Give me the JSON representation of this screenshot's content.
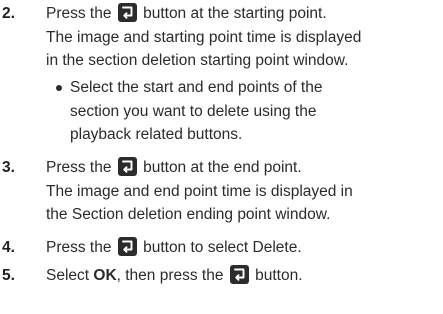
{
  "steps": [
    {
      "number": "2.",
      "lines": [
        {
          "before": "Press the ",
          "after": " button at the starting point."
        },
        {
          "text": "The image and starting point time is displayed"
        },
        {
          "text": "in the section deletion starting point window."
        }
      ],
      "bullet": [
        "Select the start and end points of the",
        "section you want to delete using the",
        "playback related buttons."
      ]
    },
    {
      "number": "3.",
      "lines": [
        {
          "before": "Press the ",
          "after": " button at the end point."
        },
        {
          "text": "The image and end point time is displayed in"
        },
        {
          "text": "the Section deletion ending point window."
        }
      ]
    },
    {
      "number": "4.",
      "lines": [
        {
          "before": "Press the ",
          "after": " button to select Delete."
        }
      ]
    },
    {
      "number": "5.",
      "lines": [
        {
          "before": "Select ",
          "bold": "OK",
          "middle": ", then press the ",
          "after": " button."
        }
      ]
    }
  ],
  "icons": {
    "enter_button": "enter-button-icon"
  },
  "colors": {
    "text": "#2b2b2b",
    "icon_bg": "#2b2b2b",
    "icon_fg": "#ffffff"
  }
}
